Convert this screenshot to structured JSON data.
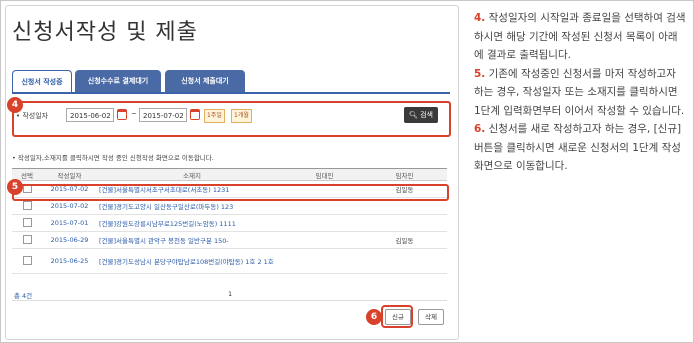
{
  "page": {
    "title": "신청서작성 및 제출"
  },
  "tabs": [
    {
      "label": "신청서 작성중"
    },
    {
      "label": "신청수수료 결제대기"
    },
    {
      "label": "신청서 제출대기"
    }
  ],
  "search": {
    "label": "• 작성일자",
    "start_date": "2015-06-02",
    "separator": "~",
    "end_date": "2015-07-02",
    "period_buttons": [
      "1주일",
      "1개월"
    ],
    "button_label": "검색"
  },
  "badges": {
    "search": "4",
    "row": "5",
    "new": "6"
  },
  "note": "• 작성일자,소재지를 클릭하시면 작성 중인 신청작성 화면으로 이동합니다.",
  "table": {
    "headers": [
      "선택",
      "작성일자",
      "소재지",
      "임대인",
      "임차인"
    ],
    "rows": [
      {
        "date": "2015-07-02",
        "address": "[건물]서울특별시서초구서초대로(서초동) 1231",
        "lessor": "",
        "lessee": "김일동"
      },
      {
        "date": "2015-07-02",
        "address": "[건물]경기도고양시 일산동구일산로(마두동) 123",
        "lessor": "",
        "lessee": ""
      },
      {
        "date": "2015-07-01",
        "address": "[건물]강원도강릉시남부로125번길(노암동) 1111",
        "lessor": "",
        "lessee": ""
      },
      {
        "date": "2015-06-29",
        "address": "[건물]서울특별시 관악구 봉천동 일반구분 150-",
        "lessor": "",
        "lessee": "김일동"
      },
      {
        "date": "2015-06-25",
        "address": "[건물]경기도성남시 분당구야탑남로108번길(야탑동) 1호 2 1호",
        "lessor": "",
        "lessee": ""
      }
    ]
  },
  "total": "총 4건",
  "pager": "1",
  "buttons": {
    "new": "신규",
    "delete": "삭제"
  },
  "description": {
    "item4": {
      "num": "4.",
      "text": "작성일자의 시작일과 종료일을 선택하여 검색하시면 해당 기간에 작성된 신청서 목록이 아래에 결과로 출력됩니다."
    },
    "item5": {
      "num": "5.",
      "text": "기존에 작성중인 신청서를 마저 작성하고자 하는 경우, 작성일자 또는 소재지를 클릭하시면 1단계 입력화면부터 이어서 작성할 수 있습니다."
    },
    "item6": {
      "num": "6.",
      "text": "신청서를 새로 작성하고자 하는 경우, [신규] 버튼을 클릭하시면 새로운 신청서의 1단계 작성화면으로 이동합니다."
    }
  },
  "colors": {
    "accent": "#d9412b",
    "tab_blue": "#4a6aa5",
    "link_blue": "#2a5aa8"
  }
}
